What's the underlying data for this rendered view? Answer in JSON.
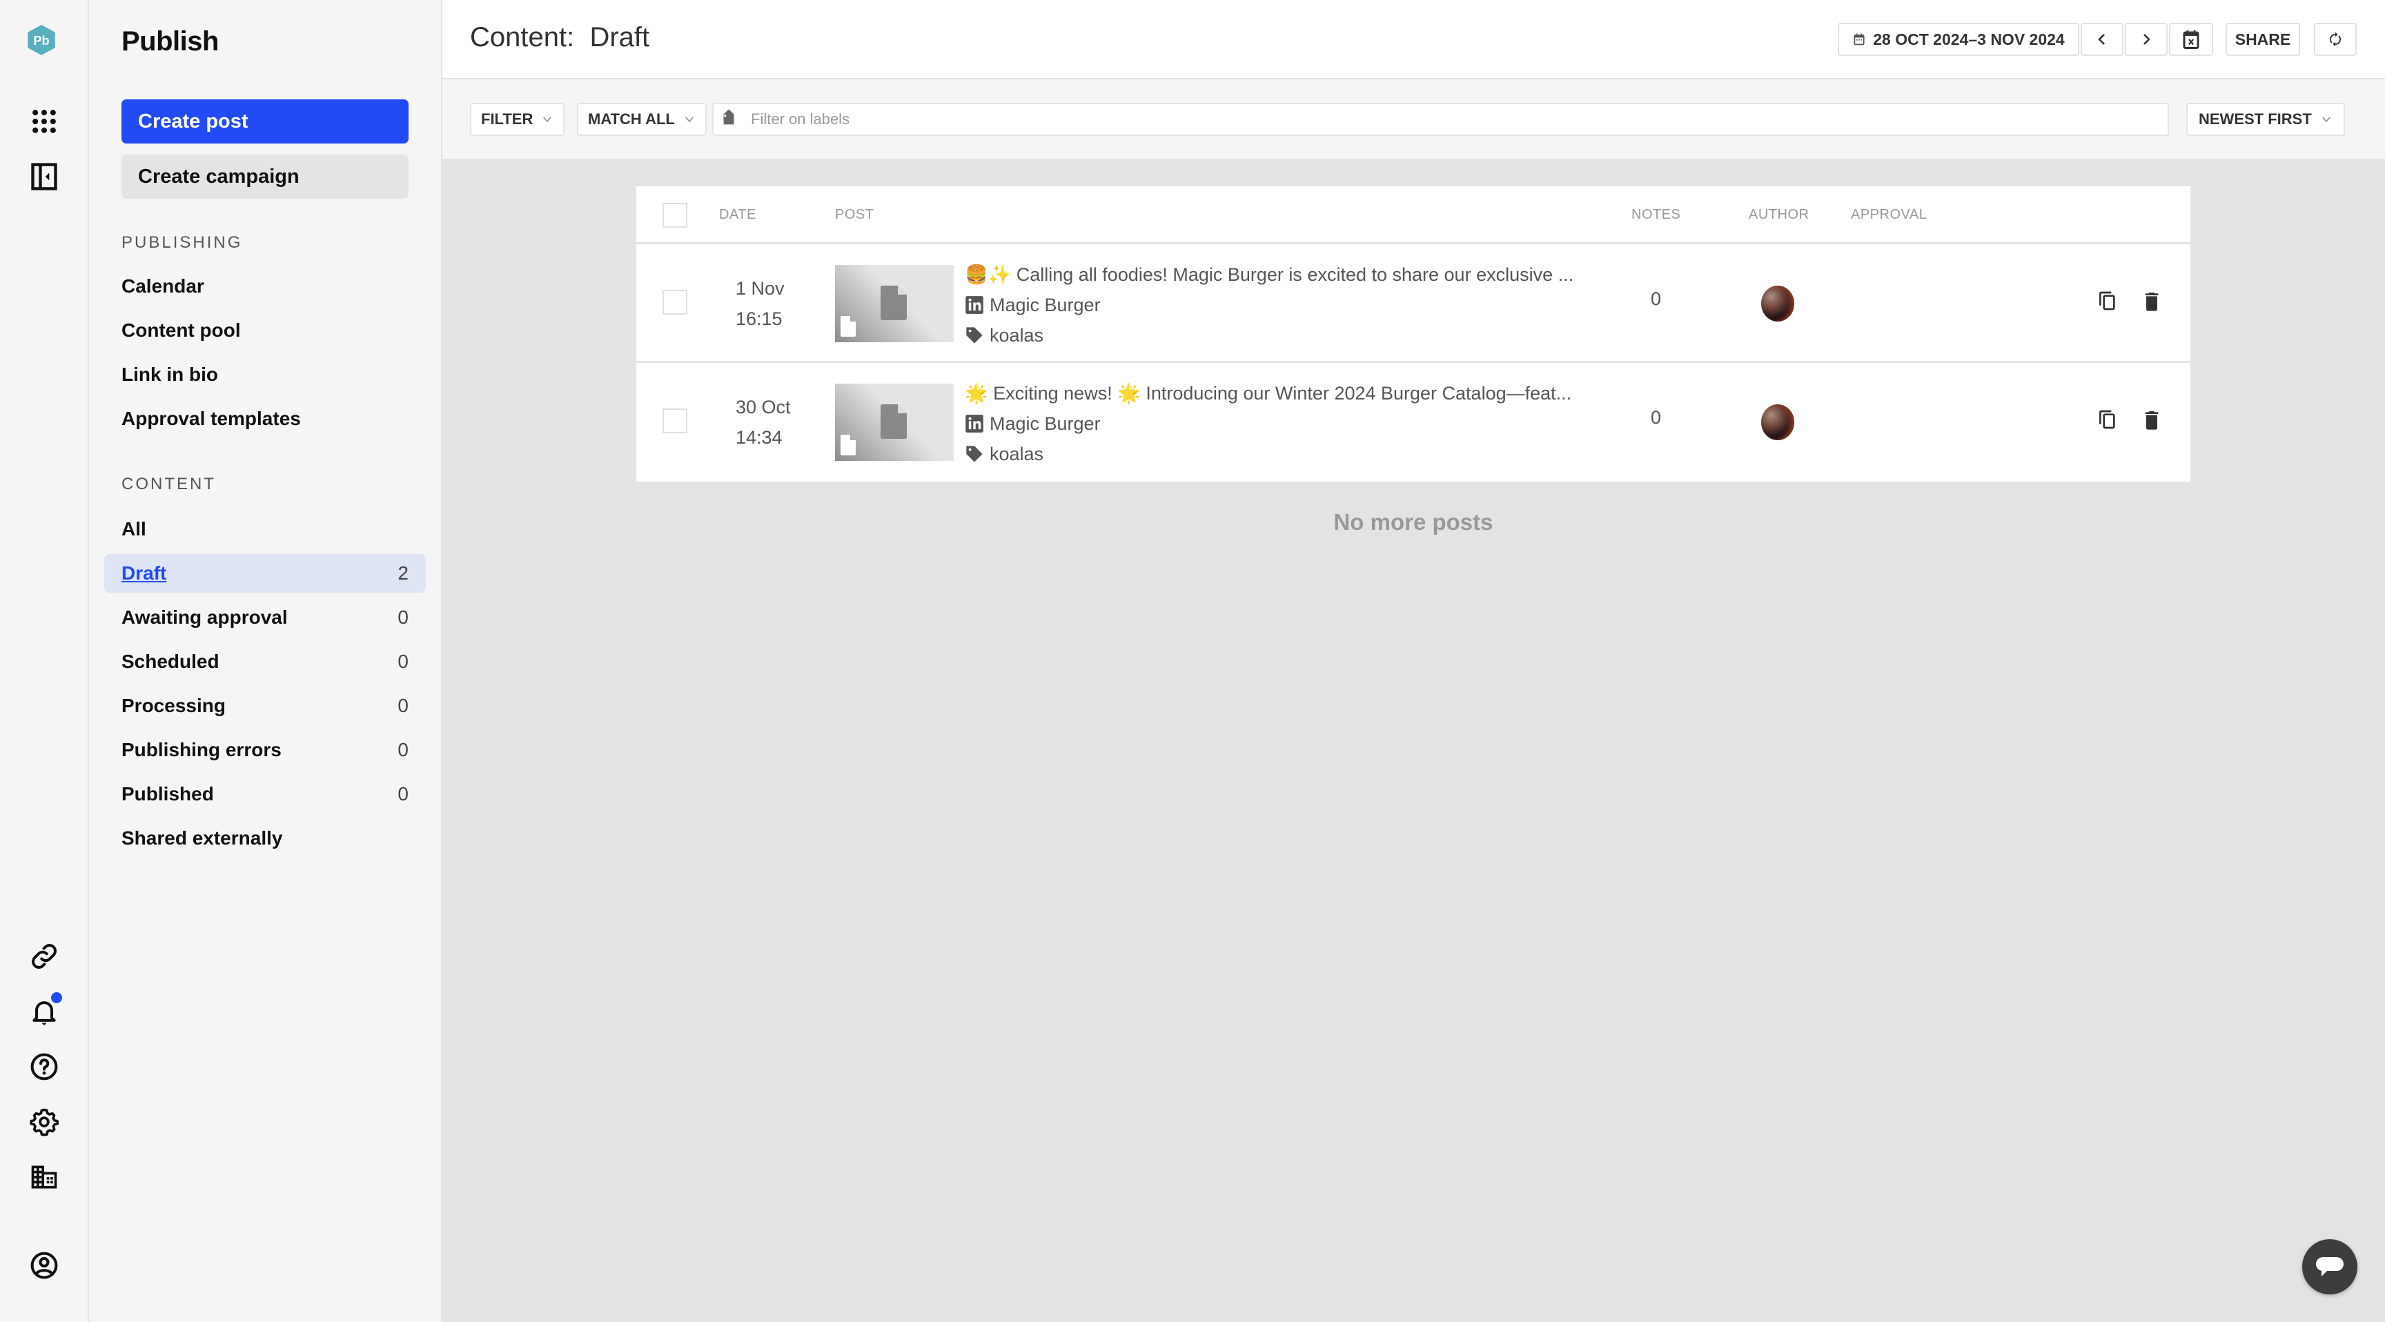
{
  "app": {
    "logo_text": "Pb",
    "title": "Publish",
    "brand_color": "#234bf5",
    "logo_color": "#5aafbf"
  },
  "rail": {
    "top_icons": [
      "apps-grid-icon",
      "collapse-sidebar-icon"
    ],
    "bottom_icons": [
      "link-icon",
      "bell-icon",
      "help-icon",
      "gear-icon",
      "building-icon",
      "account-icon"
    ],
    "notifications_unread": true
  },
  "sidebar": {
    "create_post_label": "Create post",
    "create_campaign_label": "Create campaign",
    "publishing_section": {
      "title": "PUBLISHING",
      "items": [
        {
          "label": "Calendar"
        },
        {
          "label": "Content pool"
        },
        {
          "label": "Link in bio"
        },
        {
          "label": "Approval templates"
        }
      ]
    },
    "content_section": {
      "title": "CONTENT",
      "items": [
        {
          "label": "All",
          "count": ""
        },
        {
          "label": "Draft",
          "count": "2",
          "active": true
        },
        {
          "label": "Awaiting approval",
          "count": "0"
        },
        {
          "label": "Scheduled",
          "count": "0"
        },
        {
          "label": "Processing",
          "count": "0"
        },
        {
          "label": "Publishing errors",
          "count": "0"
        },
        {
          "label": "Published",
          "count": "0"
        },
        {
          "label": "Shared externally",
          "count": ""
        }
      ]
    }
  },
  "header": {
    "title": "Content:  Draft",
    "date_range": "28 OCT 2024–3 NOV 2024",
    "share_label": "SHARE"
  },
  "filter_bar": {
    "filter_label": "FILTER",
    "match_label": "MATCH ALL",
    "labels_placeholder": "Filter on labels",
    "labels_value": "",
    "sort_label": "NEWEST FIRST"
  },
  "table": {
    "columns": {
      "date": "DATE",
      "post": "POST",
      "notes": "NOTES",
      "author": "AUTHOR",
      "approval": "APPROVAL"
    },
    "rows": [
      {
        "date": "1 Nov",
        "time": "16:15",
        "text": "🍔✨ Calling all foodies! Magic Burger is excited to share our exclusive ...",
        "account": "Magic Burger",
        "network": "linkedin",
        "label": "koalas",
        "notes": "0",
        "approval": ""
      },
      {
        "date": "30 Oct",
        "time": "14:34",
        "text": "🌟 Exciting news! 🌟 Introducing our Winter 2024 Burger Catalog—feat...",
        "account": "Magic Burger",
        "network": "linkedin",
        "label": "koalas",
        "notes": "0",
        "approval": ""
      }
    ],
    "end_message": "No more posts"
  }
}
